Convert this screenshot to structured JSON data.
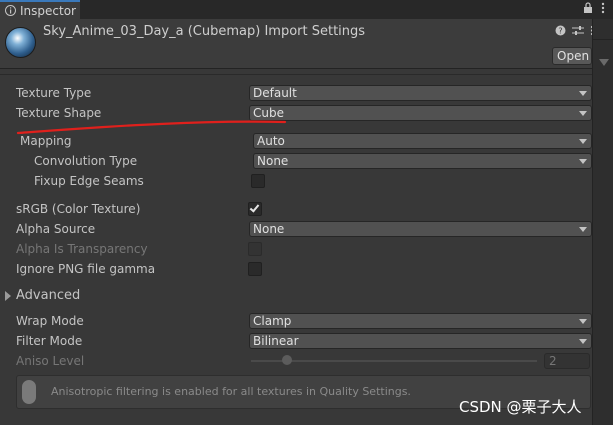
{
  "tab": {
    "label": "Inspector",
    "icon": "info-icon"
  },
  "title_controls": [
    "lock-icon",
    "more-icon"
  ],
  "header": {
    "title": "Sky_Anime_03_Day_a (Cubemap) Import Settings",
    "help_icon": "help-icon",
    "settings_icon": "sliders-icon",
    "menu_icon": "more-icon",
    "open_button": "Open"
  },
  "fields": {
    "texture_type": {
      "label": "Texture Type",
      "value": "Default"
    },
    "texture_shape": {
      "label": "Texture Shape",
      "value": "Cube"
    },
    "mapping": {
      "label": "Mapping",
      "value": "Auto"
    },
    "convolution_type": {
      "label": "Convolution Type",
      "value": "None"
    },
    "fixup_edge_seams": {
      "label": "Fixup Edge Seams",
      "checked": false
    },
    "srgb": {
      "label": "sRGB (Color Texture)",
      "checked": true
    },
    "alpha_source": {
      "label": "Alpha Source",
      "value": "None"
    },
    "alpha_is_transparency": {
      "label": "Alpha Is Transparency",
      "checked": false
    },
    "ignore_png_gamma": {
      "label": "Ignore PNG file gamma",
      "checked": false
    },
    "advanced": {
      "label": "Advanced",
      "expanded": false
    },
    "wrap_mode": {
      "label": "Wrap Mode",
      "value": "Clamp"
    },
    "filter_mode": {
      "label": "Filter Mode",
      "value": "Bilinear"
    },
    "aniso_level": {
      "label": "Aniso Level",
      "value": "2",
      "fraction": 0.125
    }
  },
  "help": {
    "text": "Anisotropic filtering is enabled for all textures in Quality Settings."
  },
  "annotation_color": "#e0201c",
  "watermark": "CSDN @栗子大人"
}
